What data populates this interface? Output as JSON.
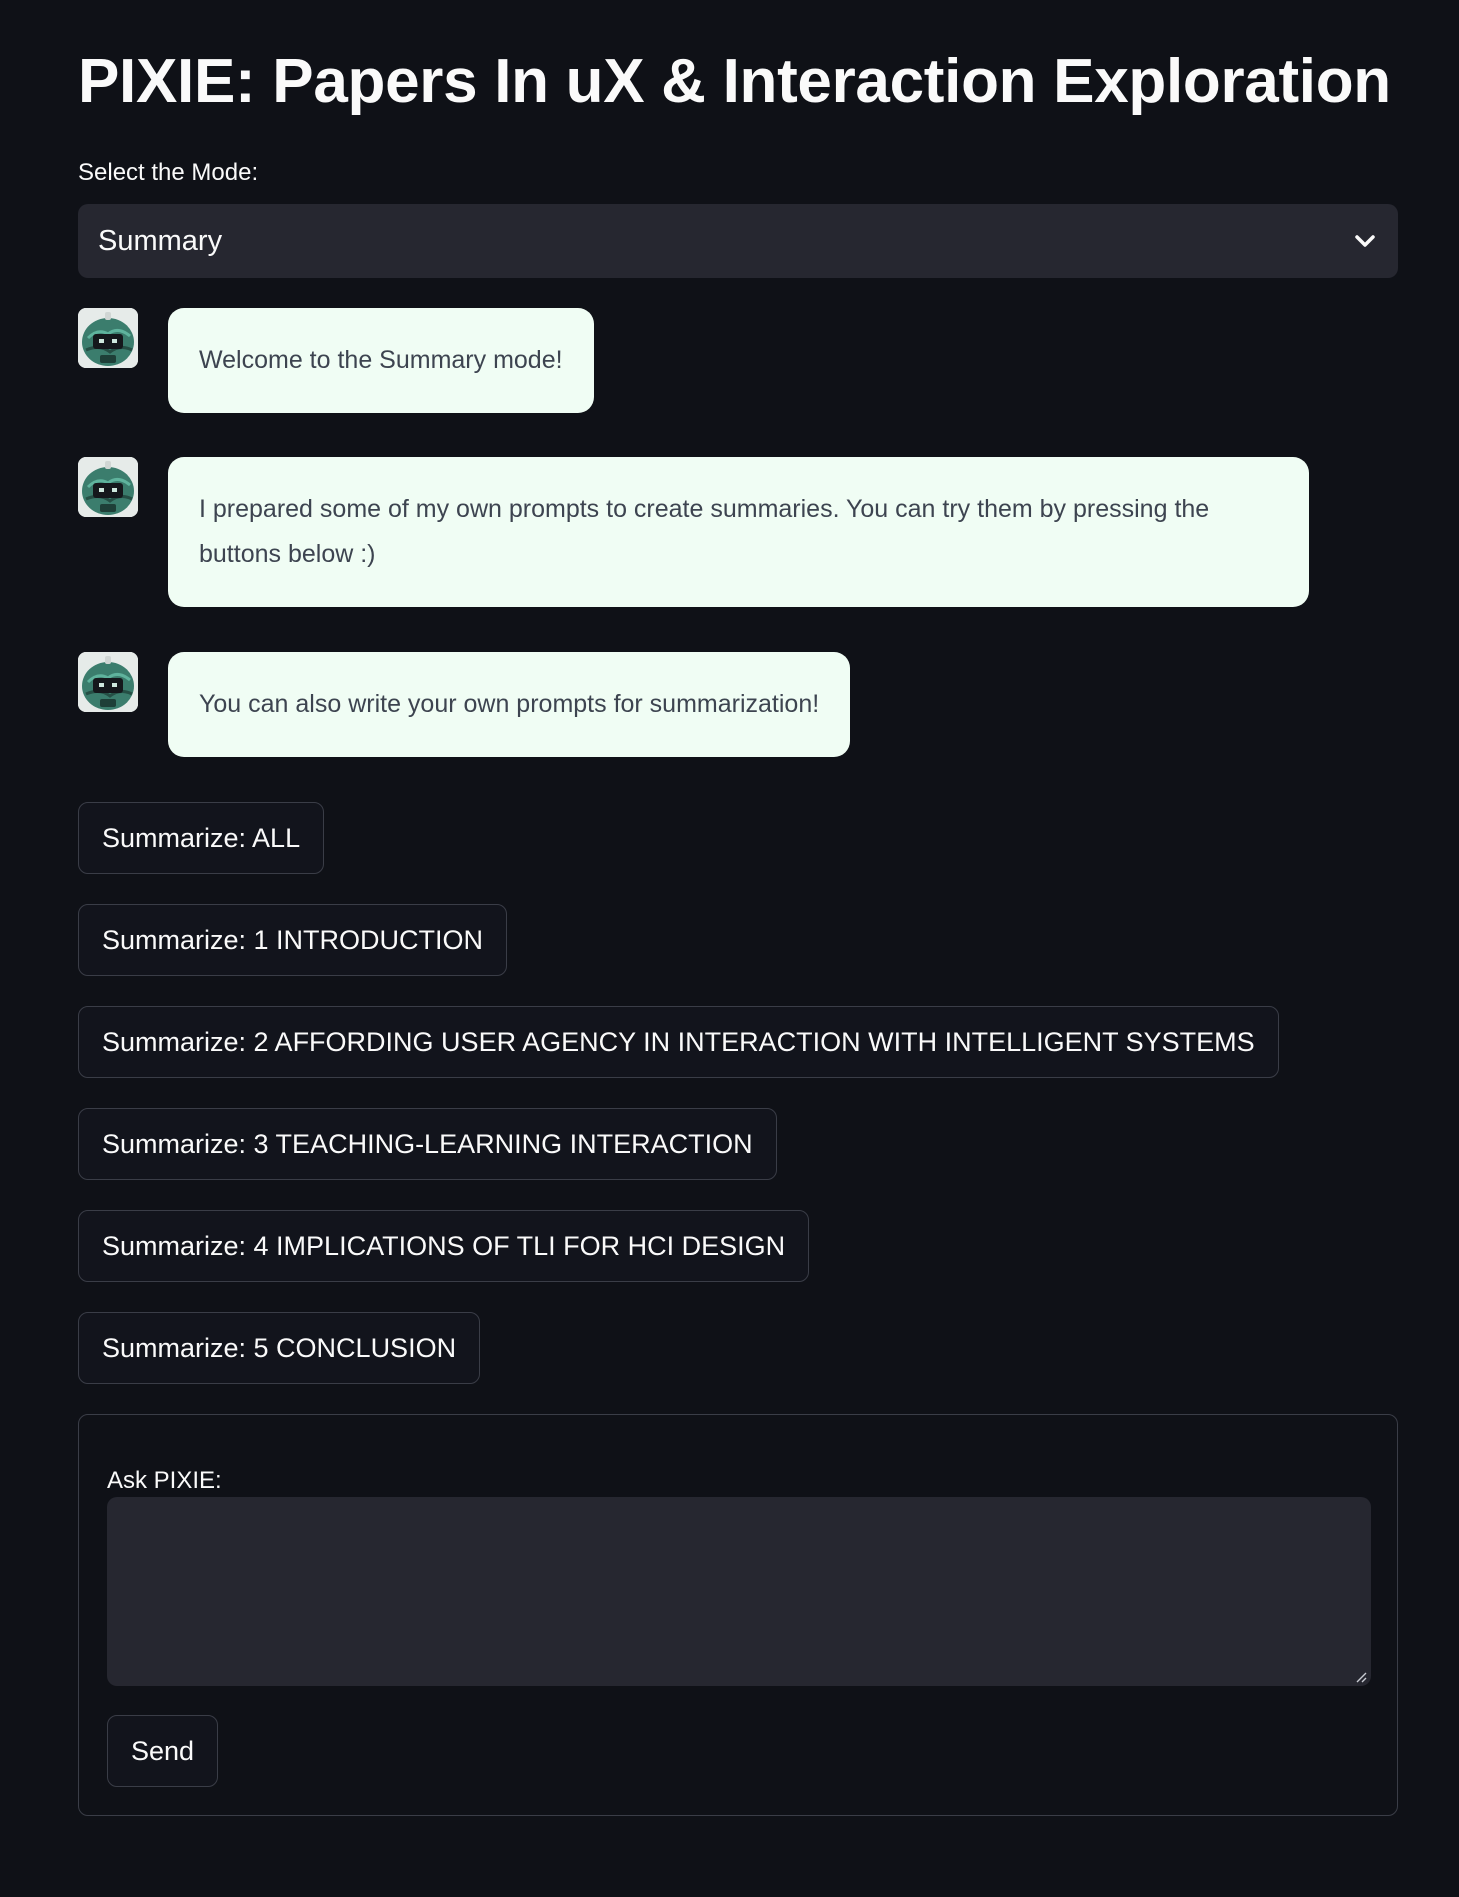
{
  "header": {
    "title": "PIXIE: Papers In uX & Interaction Exploration"
  },
  "mode": {
    "label": "Select the Mode:",
    "selected": "Summary",
    "icon": "chevron-down-icon"
  },
  "chat": {
    "messages": [
      {
        "role": "assistant",
        "avatar": "robot-avatar",
        "text": "Welcome to the Summary mode!"
      },
      {
        "role": "assistant",
        "avatar": "robot-avatar",
        "text": "I prepared some of my own prompts to create summaries. You can try them by pressing the buttons below :)"
      },
      {
        "role": "assistant",
        "avatar": "robot-avatar",
        "text": "You can also write your own prompts for summarization!"
      }
    ]
  },
  "summary_buttons": [
    "Summarize: ALL",
    "Summarize: 1 INTRODUCTION",
    "Summarize: 2 AFFORDING USER AGENCY IN INTERACTION WITH INTELLIGENT SYSTEMS",
    "Summarize: 3 TEACHING-LEARNING INTERACTION",
    "Summarize: 4 IMPLICATIONS OF TLI FOR HCI DESIGN",
    "Summarize: 5 CONCLUSION"
  ],
  "ask_form": {
    "label": "Ask PIXIE:",
    "value": "",
    "send_label": "Send"
  },
  "colors": {
    "background": "#0f1117",
    "input_background": "#262730",
    "bubble_background": "#f0fdf4",
    "bubble_text": "#3d4450",
    "border": "#3a3d47",
    "avatar_green": "#2f7a6a"
  }
}
